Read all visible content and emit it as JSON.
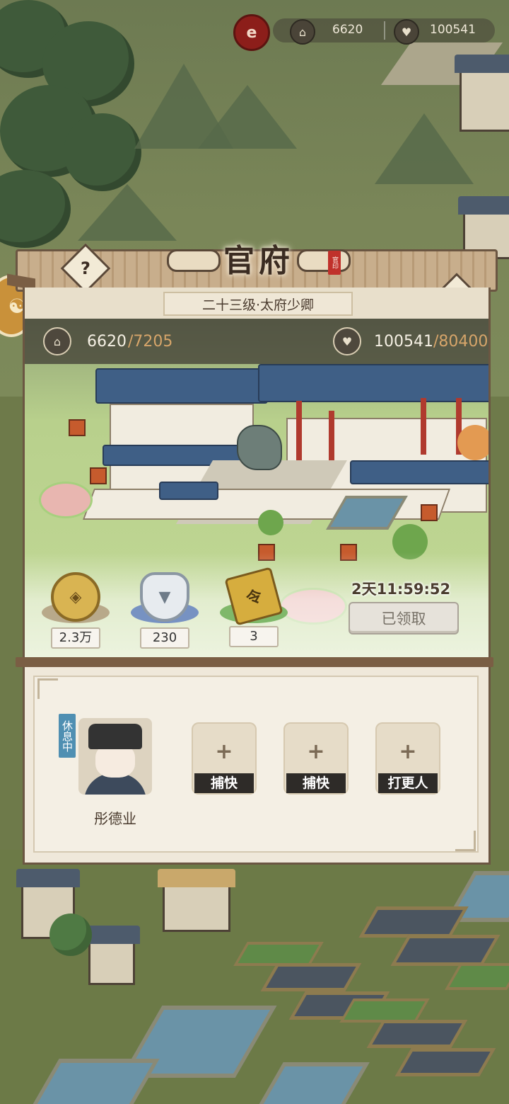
{
  "hud": {
    "red_badge": "e",
    "population": "6620",
    "prosperity": "100541"
  },
  "panel": {
    "title": "官府",
    "seal_text": "官印",
    "help_label": "?",
    "rank": "二十三级·太府少卿",
    "population_current": "6620",
    "population_max": "/7205",
    "prosperity_current": "100541",
    "prosperity_max": "/80400",
    "rewards": [
      {
        "icon": "copper-coin-icon",
        "count": "2.3万"
      },
      {
        "icon": "silver-ingot-icon",
        "count": "230"
      },
      {
        "icon": "token-plaque-icon",
        "count": "3"
      }
    ],
    "timer": "2天11:59:52",
    "claim_label": "已领取",
    "staff": {
      "status": "休息中",
      "officer_name": "彤德业",
      "slots": [
        "捕快",
        "捕快",
        "打更人"
      ]
    }
  },
  "colors": {
    "frame": "#6b5642",
    "roof_blue": "#3f5f86",
    "accent_red": "#c0312b",
    "status_blue": "#4f8fb2"
  }
}
